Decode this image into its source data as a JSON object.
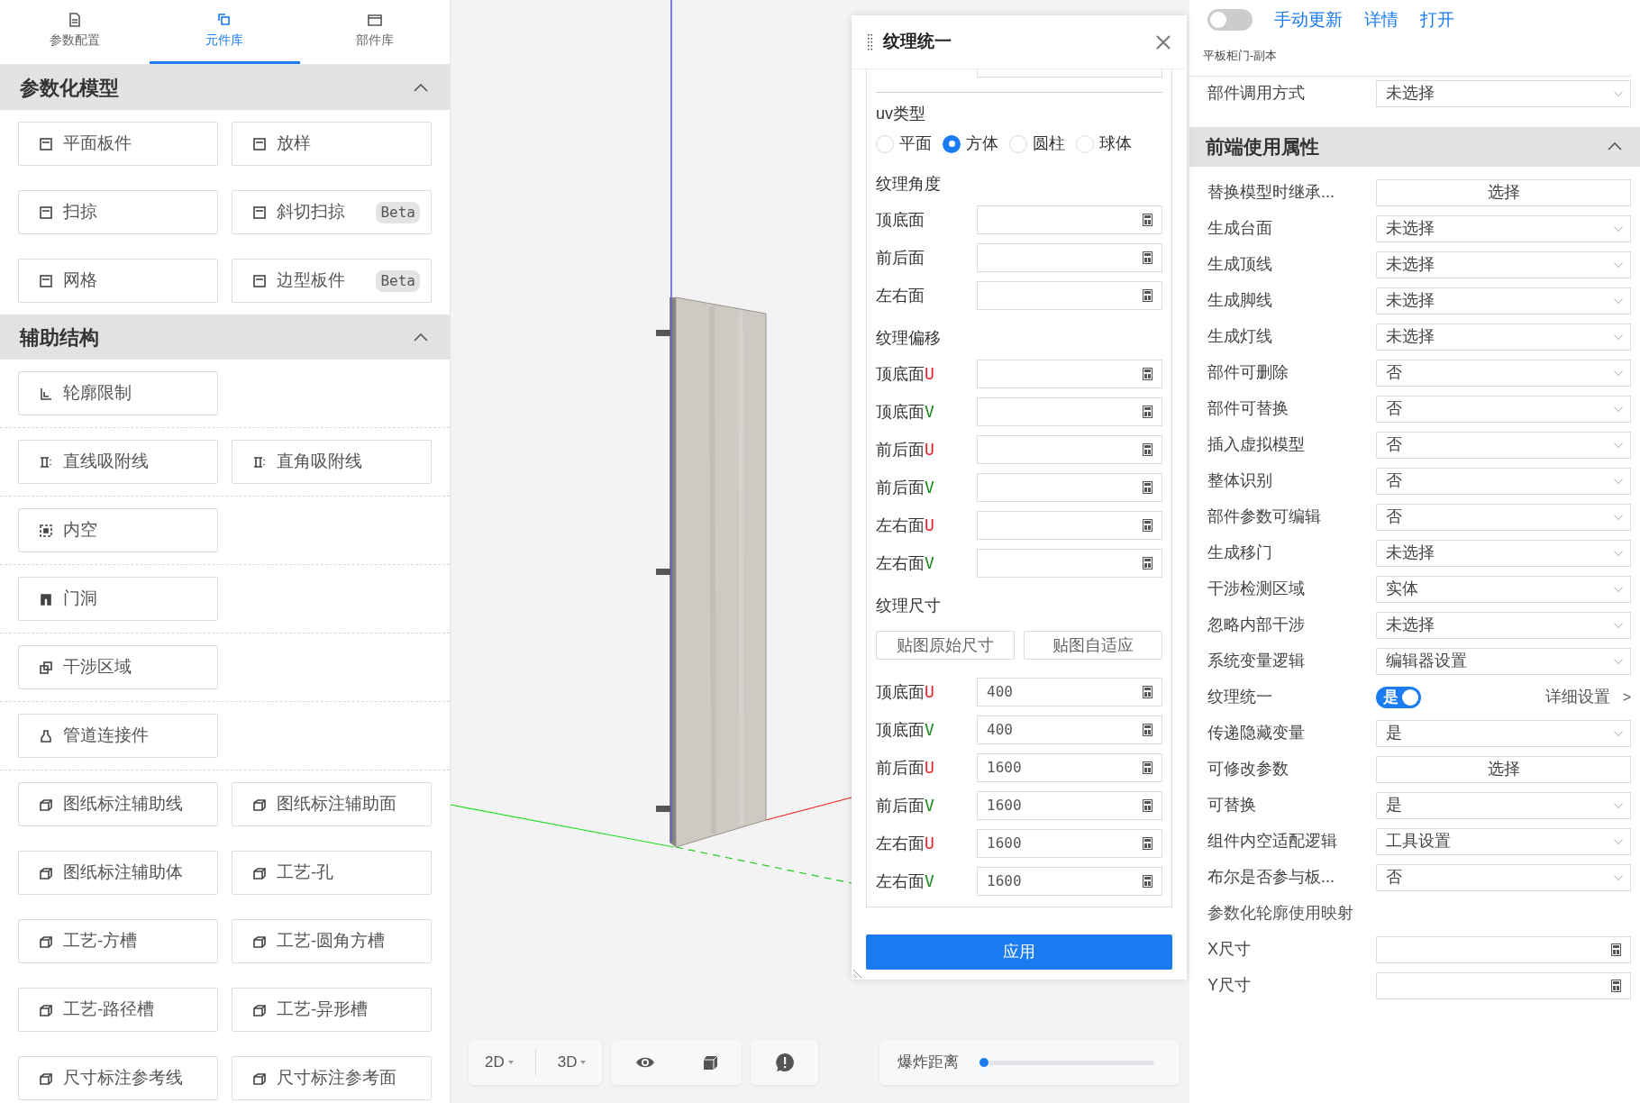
{
  "left_panel": {
    "tabs": [
      {
        "label": "参数配置",
        "kind": "doc",
        "selected": false
      },
      {
        "label": "元件库",
        "kind": "squares",
        "selected": true
      },
      {
        "label": "部件库",
        "kind": "folder",
        "selected": false
      }
    ],
    "sections": [
      {
        "title": "参数化模型",
        "expanded": true,
        "groups": [
          [
            [
              {
                "label": "平面板件",
                "kind": "panel"
              },
              {
                "label": "放样",
                "kind": "panel"
              }
            ],
            [
              {
                "label": "扫掠",
                "kind": "panel"
              },
              {
                "label": "斜切扫掠",
                "kind": "panel",
                "badge": "Beta"
              }
            ],
            [
              {
                "label": "网格",
                "kind": "panel"
              },
              {
                "label": "边型板件",
                "kind": "panel",
                "badge": "Beta"
              }
            ]
          ]
        ]
      },
      {
        "title": "辅助结构",
        "expanded": true,
        "groups": [
          [
            [
              {
                "label": "轮廓限制",
                "kind": "contour"
              }
            ]
          ],
          [
            [
              {
                "label": "直线吸附线",
                "kind": "snap"
              },
              {
                "label": "直角吸附线",
                "kind": "snap"
              }
            ]
          ],
          [
            [
              {
                "label": "内空",
                "kind": "hollow"
              }
            ]
          ],
          [
            [
              {
                "label": "门洞",
                "kind": "door"
              }
            ]
          ],
          [
            [
              {
                "label": "干涉区域",
                "kind": "overlap"
              }
            ]
          ],
          [
            [
              {
                "label": "管道连接件",
                "kind": "pipe"
              }
            ]
          ],
          [
            [
              {
                "label": "图纸标注辅助线",
                "kind": "mark"
              },
              {
                "label": "图纸标注辅助面",
                "kind": "mark"
              }
            ],
            [
              {
                "label": "图纸标注辅助体",
                "kind": "mark"
              },
              {
                "label": "工艺-孔",
                "kind": "mark"
              }
            ],
            [
              {
                "label": "工艺-方槽",
                "kind": "mark"
              },
              {
                "label": "工艺-圆角方槽",
                "kind": "mark"
              }
            ],
            [
              {
                "label": "工艺-路径槽",
                "kind": "mark"
              },
              {
                "label": "工艺-异形槽",
                "kind": "mark"
              }
            ],
            [
              {
                "label": "尺寸标注参考线",
                "kind": "mark"
              },
              {
                "label": "尺寸标注参考面",
                "kind": "mark"
              }
            ]
          ]
        ]
      }
    ]
  },
  "viewport": {
    "toolbar": {
      "views": [
        "2D",
        "3D"
      ],
      "explode": {
        "label": "爆炸距离",
        "level": 0
      }
    }
  },
  "dialog": {
    "title": "纹理统一",
    "uv_type": {
      "label": "uv类型",
      "options": [
        {
          "label": "平面",
          "selected": false
        },
        {
          "label": "方体",
          "selected": true
        },
        {
          "label": "圆柱",
          "selected": false
        },
        {
          "label": "球体",
          "selected": false
        }
      ]
    },
    "angle": {
      "label": "纹理角度",
      "fields": [
        {
          "label": "顶底面"
        },
        {
          "label": "前后面"
        },
        {
          "label": "左右面"
        }
      ]
    },
    "offset": {
      "label": "纹理偏移",
      "fields": [
        {
          "label": "顶底面",
          "suffix": "U",
          "color": "#e8212b"
        },
        {
          "label": "顶底面",
          "suffix": "V",
          "color": "#1a8a1a"
        },
        {
          "label": "前后面",
          "suffix": "U",
          "color": "#e8212b"
        },
        {
          "label": "前后面",
          "suffix": "V",
          "color": "#1a8a1a"
        },
        {
          "label": "左右面",
          "suffix": "U",
          "color": "#e8212b"
        },
        {
          "label": "左右面",
          "suffix": "V",
          "color": "#1a8a1a"
        }
      ]
    },
    "size": {
      "label": "纹理尺寸",
      "buttons": [
        "贴图原始尺寸",
        "贴图自适应"
      ],
      "fields": [
        {
          "label": "顶底面",
          "suffix": "U",
          "color": "#e8212b",
          "value": "400"
        },
        {
          "label": "顶底面",
          "suffix": "V",
          "color": "#1a8a1a",
          "value": "400"
        },
        {
          "label": "前后面",
          "suffix": "U",
          "color": "#e8212b",
          "value": "1600"
        },
        {
          "label": "前后面",
          "suffix": "V",
          "color": "#1a8a1a",
          "value": "1600"
        },
        {
          "label": "左右面",
          "suffix": "U",
          "color": "#e8212b",
          "value": "1600"
        },
        {
          "label": "左右面",
          "suffix": "V",
          "color": "#1a8a1a",
          "value": "1600"
        }
      ]
    },
    "apply_button": "应用"
  },
  "right_panel": {
    "auto_update": {
      "on": false
    },
    "links": [
      "手动更新",
      "详情",
      "打开"
    ],
    "name": "平板柜门-副本",
    "top_rows": [
      {
        "kind": "select",
        "label": "部件调用方式",
        "value": "未选择"
      }
    ],
    "section": {
      "title": "前端使用属性",
      "expanded": true
    },
    "rows": [
      {
        "kind": "button",
        "label": "替换模型时继承...",
        "value": "选择"
      },
      {
        "kind": "select",
        "label": "生成台面",
        "value": "未选择"
      },
      {
        "kind": "select",
        "label": "生成顶线",
        "value": "未选择"
      },
      {
        "kind": "select",
        "label": "生成脚线",
        "value": "未选择"
      },
      {
        "kind": "select",
        "label": "生成灯线",
        "value": "未选择"
      },
      {
        "kind": "select",
        "label": "部件可删除",
        "value": "否"
      },
      {
        "kind": "select",
        "label": "部件可替换",
        "value": "否"
      },
      {
        "kind": "select",
        "label": "插入虚拟模型",
        "value": "否"
      },
      {
        "kind": "select",
        "label": "整体识别",
        "value": "否"
      },
      {
        "kind": "select",
        "label": "部件参数可编辑",
        "value": "否"
      },
      {
        "kind": "select",
        "label": "生成移门",
        "value": "未选择"
      },
      {
        "kind": "select",
        "label": "干涉检测区域",
        "value": "实体"
      },
      {
        "kind": "select",
        "label": "忽略内部干涉",
        "value": "未选择"
      },
      {
        "kind": "select",
        "label": "系统变量逻辑",
        "value": "编辑器设置"
      },
      {
        "kind": "toggle",
        "label": "纹理统一",
        "value": "是",
        "on": true,
        "link": "详细设置",
        "link_arrow": ">"
      },
      {
        "kind": "select",
        "label": "传递隐藏变量",
        "value": "是"
      },
      {
        "kind": "button",
        "label": "可修改参数",
        "value": "选择"
      },
      {
        "kind": "select",
        "label": "可替换",
        "value": "是"
      },
      {
        "kind": "select",
        "label": "组件内空适配逻辑",
        "value": "工具设置"
      },
      {
        "kind": "select",
        "label": "布尔是否参与板...",
        "value": "否"
      },
      {
        "kind": "heading",
        "label": "参数化轮廓使用映射"
      },
      {
        "kind": "input",
        "label": "X尺寸"
      },
      {
        "kind": "input",
        "label": "Y尺寸"
      }
    ]
  }
}
